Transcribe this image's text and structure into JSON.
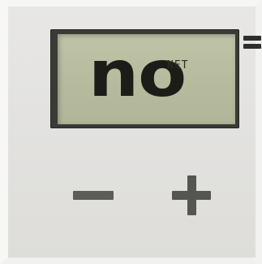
{
  "display": {
    "main_text": "no",
    "super_text": "NET",
    "indicator_icon": "equals-icon"
  },
  "controls": {
    "minus_label": "−",
    "plus_label": "+"
  },
  "colors": {
    "lcd_background": "#b6bb9d",
    "lcd_segments": "#1c1d19",
    "bezel": "#3a3b37",
    "panel": "#e3e2e0",
    "key_symbols": "#5c5c58"
  }
}
